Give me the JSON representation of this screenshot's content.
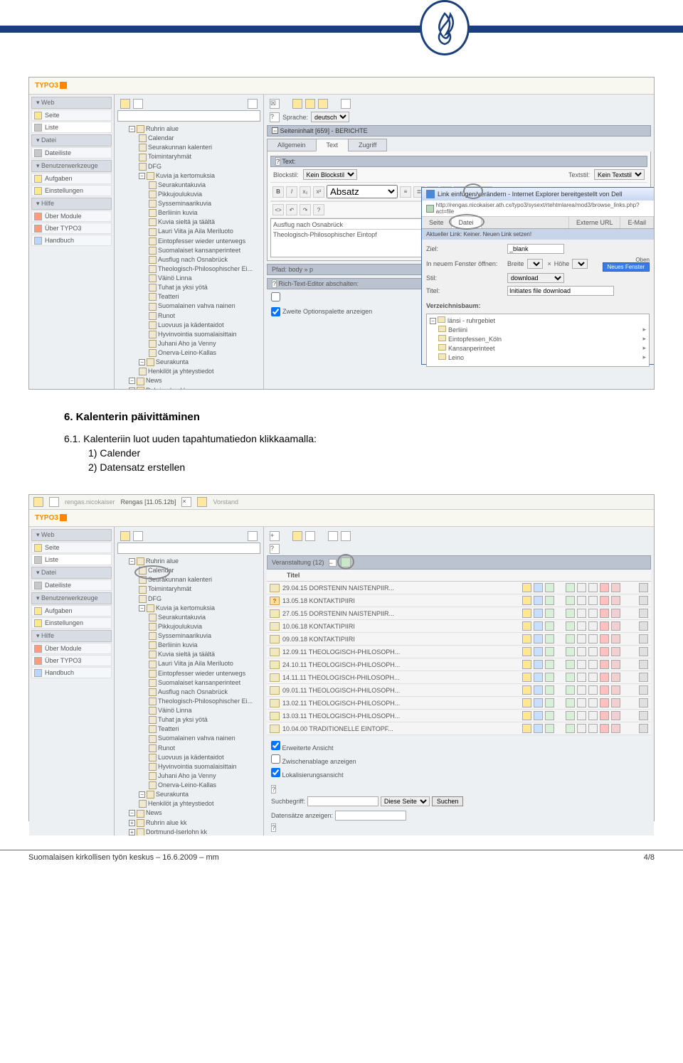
{
  "header": {
    "logo_alt": "flame-logo"
  },
  "typo3": {
    "brand": "TYPO3"
  },
  "sidebar": {
    "web": {
      "head": "Web",
      "seite": "Seite",
      "liste": "Liste"
    },
    "datei": {
      "head": "Datei",
      "dateiliste": "Dateiliste"
    },
    "benutzer": {
      "head": "Benutzerwerkzeuge",
      "aufgaben": "Aufgaben",
      "einstellungen": "Einstellungen"
    },
    "hilfe": {
      "head": "Hilfe",
      "module": "Über Module",
      "typo3": "Über TYPO3",
      "handbuch": "Handbuch"
    }
  },
  "tree": {
    "root": "Ruhrin alue",
    "items": [
      "Calendar",
      "Seurakunnan kalenteri",
      "Toimintaryhmät",
      "DFG",
      "Kuvia ja kertomuksia",
      "Seurakuntakuvia",
      "Pikkujoulukuvia",
      "Sysseminaarikuvia",
      "Berliinin kuvia",
      "Kuvia sieltä ja täältä",
      "Lauri Viita ja Aila Meriluoto",
      "Eintopfesser wieder unterwegs",
      "Suomalaiset kansanperinteet",
      "Ausflug nach Osnabrück",
      "Theologisch-Philosophischer Ei...",
      "Väinö Linna",
      "Tuhat ja yksi yötä",
      "Teatteri",
      "Suomalainen vahva nainen",
      "Runot",
      "Luovuus ja kädentaidot",
      "Hyvinvointia suomalaisittain",
      "Juhani Aho ja Venny",
      "Onerva-Leino-Kallas",
      "Seurakunta",
      "Henkilöt ja yhteystiedot",
      "News",
      "Ruhrin alue kk",
      "Dortmund-Iserlohn kk"
    ]
  },
  "edit1": {
    "sprache_lbl": "Sprache:",
    "sprache_val": "deutsch",
    "seiteninhalt": "Seiteninhalt [659] - BERICHTE",
    "tabs": {
      "allgemein": "Allgemein",
      "text": "Text",
      "zugriff": "Zugriff"
    },
    "text_lbl": "Text:",
    "blockstil_lbl": "Blockstil:",
    "blockstil_val": "Kein Blockstil",
    "textstil_lbl": "Textstil:",
    "textstil_val": "Kein Textstil",
    "absatz": "Absatz",
    "rte_line1": "Ausflug nach Osnabrück",
    "rte_line2": "Theologisch-Philosophischer Eintopf",
    "pfad": "Pfad: body » p",
    "rte_abschalten": "Rich-Text-Editor abschalten:",
    "zweite_option": "Zweite Optionspalette anzeigen"
  },
  "link_dialog": {
    "title": "Link einfügen/verändern - Internet Explorer bereitgestellt von Dell",
    "url": "http://rengas.nicokaiser.ath.cx/typo3/sysext/rtehtmlarea/mod3/browse_links.php?act=file",
    "tabs": {
      "seite": "Seite",
      "datei": "Datei",
      "externe": "Externe URL",
      "email": "E-Mail"
    },
    "banner": "Aktueller Link: Keiner. Neuen Link setzen!",
    "ziel_lbl": "Ziel:",
    "ziel_val": "_blank",
    "fenster_lbl": "In neuem Fenster öffnen:",
    "breite": "Breite",
    "hohe": "Höhe",
    "oben": "Oben",
    "neues": "Neues Fenster",
    "stil_lbl": "Stil:",
    "stil_val": "download",
    "titel_lbl": "Titel:",
    "titel_val": "Initiates file download",
    "verz": "Verzeichnisbaum:",
    "tree_root": "länsi - ruhrgebiet",
    "tree_items": [
      "Berliini",
      "Eintopfessen_Köln",
      "Kansanperinteet",
      "Leino"
    ]
  },
  "ss2": {
    "bread": {
      "a": "rengas.nicokaiser",
      "b": "Rengas [11.05.12b]",
      "c": "Vorstand"
    },
    "veranst": "Veranstaltung (12)",
    "col_titel": "Titel",
    "rows": [
      {
        "t": "29.04.15 DORSTENIN NAISTENPIIR..."
      },
      {
        "t": "13.05.18 KONTAKTIPIIRI",
        "q": true
      },
      {
        "t": "27.05.15 DORSTENIN NAISTENPIIR..."
      },
      {
        "t": "10.06.18 KONTAKTIPIIRI"
      },
      {
        "t": "09.09.18 KONTAKTIPIIRI"
      },
      {
        "t": "12.09.11 THEOLOGISCH-PHILOSOPH..."
      },
      {
        "t": "24.10.11 THEOLOGISCH-PHILOSOPH..."
      },
      {
        "t": "14.11.11 THEOLOGISCH-PHILOSOPH..."
      },
      {
        "t": "09.01.11 THEOLOGISCH-PHILOSOPH..."
      },
      {
        "t": "13.02.11 THEOLOGISCH-PHILOSOPH..."
      },
      {
        "t": "13.03.11 THEOLOGISCH-PHILOSOPH..."
      },
      {
        "t": "10.04.00 TRADITIONELLE EINTOPF..."
      }
    ],
    "erweiterte": "Erweiterte Ansicht",
    "zwischen": "Zwischenablage anzeigen",
    "lokal": "Lokalisierungsansicht",
    "such_lbl": "Suchbegriff:",
    "diese_seite": "Diese Seite",
    "suchen": "Suchen",
    "daten_lbl": "Datensätze anzeigen:"
  },
  "doc": {
    "heading": "6. Kalenterin päivittäminen",
    "intro": "6.1. Kalenteriin luot uuden tapahtumatiedon klikkaamalla:",
    "step1": "1) Calender",
    "step2": "2) Datensatz erstellen"
  },
  "footer": {
    "left": "Suomalaisen kirkollisen työn keskus – 16.6.2009 – mm",
    "right": "4/8"
  }
}
